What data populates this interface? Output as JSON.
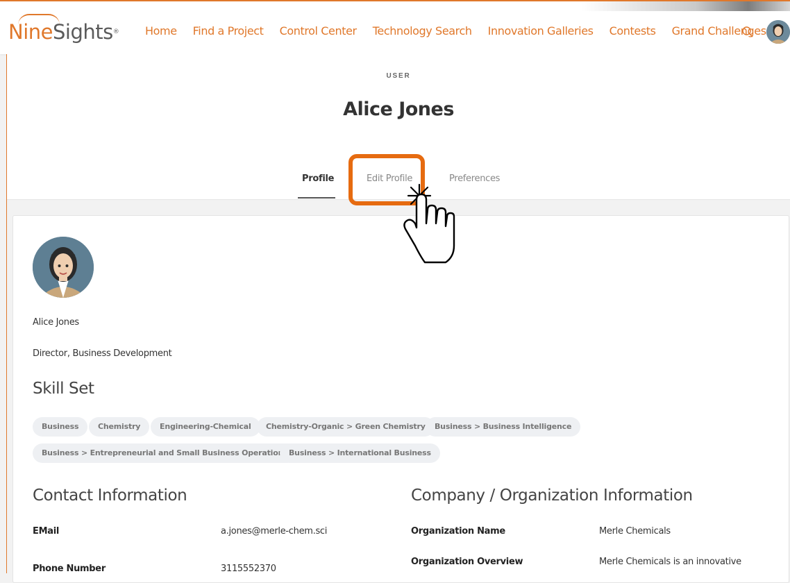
{
  "brand": {
    "logo_text_1": "Nine",
    "logo_text_2": "Sights",
    "logo_reg": "®",
    "accent": "#e0782b"
  },
  "nav": {
    "items": [
      {
        "label": "Home"
      },
      {
        "label": "Find a Project"
      },
      {
        "label": "Control Center"
      },
      {
        "label": "Technology Search"
      },
      {
        "label": "Innovation Galleries"
      },
      {
        "label": "Contests"
      },
      {
        "label": "Grand Challenges"
      }
    ],
    "search_icon": "search-icon",
    "avatar": "user-avatar"
  },
  "header": {
    "kicker": "USER",
    "title": "Alice Jones",
    "tabs": [
      {
        "label": "Profile",
        "active": true
      },
      {
        "label": "Edit Profile",
        "active": false
      },
      {
        "label": "Preferences",
        "active": false
      }
    ]
  },
  "profile": {
    "name": "Alice Jones",
    "role": "Director, Business Development",
    "skills_heading": "Skill Set",
    "skills": [
      "Business",
      "Chemistry",
      "Engineering-Chemical",
      "Chemistry-Organic > Green Chemistry",
      "Business > Business Intelligence",
      "Business > Entrepreneurial and Small Business Operations",
      "Business > International Business"
    ]
  },
  "contact": {
    "heading": "Contact Information",
    "rows": [
      {
        "label": "EMail",
        "value": "a.jones@merle-chem.sci"
      },
      {
        "label": "Phone Number",
        "value": "3115552370"
      }
    ]
  },
  "organization": {
    "heading": "Company / Organization Information",
    "rows": [
      {
        "label": "Organization Name",
        "value": "Merle Chemicals"
      },
      {
        "label": "Organization Overview",
        "value": "Merle Chemicals is an innovative"
      }
    ]
  },
  "colors": {
    "highlight": "#e66b10",
    "chip_bg": "#eef0f3"
  }
}
